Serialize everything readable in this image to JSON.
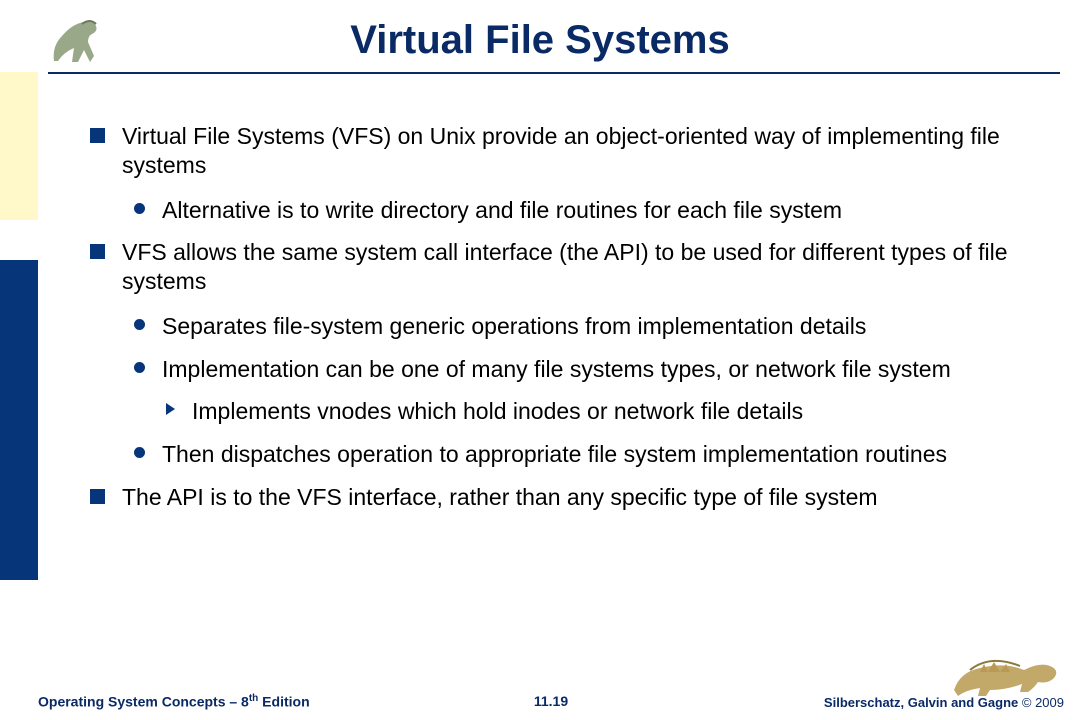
{
  "title": "Virtual File Systems",
  "bullets": {
    "b1": "Virtual File Systems (VFS) on Unix provide an object-oriented way of implementing file systems",
    "b1a": "Alternative is to write directory and file routines for each file system",
    "b2": "VFS allows the same system call interface (the API) to be used for different types of file systems",
    "b2a": "Separates file-system generic operations from implementation details",
    "b2b": "Implementation can be one of many file systems types, or network file system",
    "b2b1": "Implements vnodes which hold inodes or network file details",
    "b2c": "Then dispatches operation to appropriate file system implementation routines",
    "b3": "The API is to the VFS interface, rather than any specific type of file system"
  },
  "footer": {
    "left_prefix": "Operating System Concepts – 8",
    "left_sup": "th",
    "left_suffix": " Edition",
    "center": "11.19",
    "right_authors": "Silberschatz, Galvin and Gagne ",
    "right_copy": "© 2009"
  }
}
